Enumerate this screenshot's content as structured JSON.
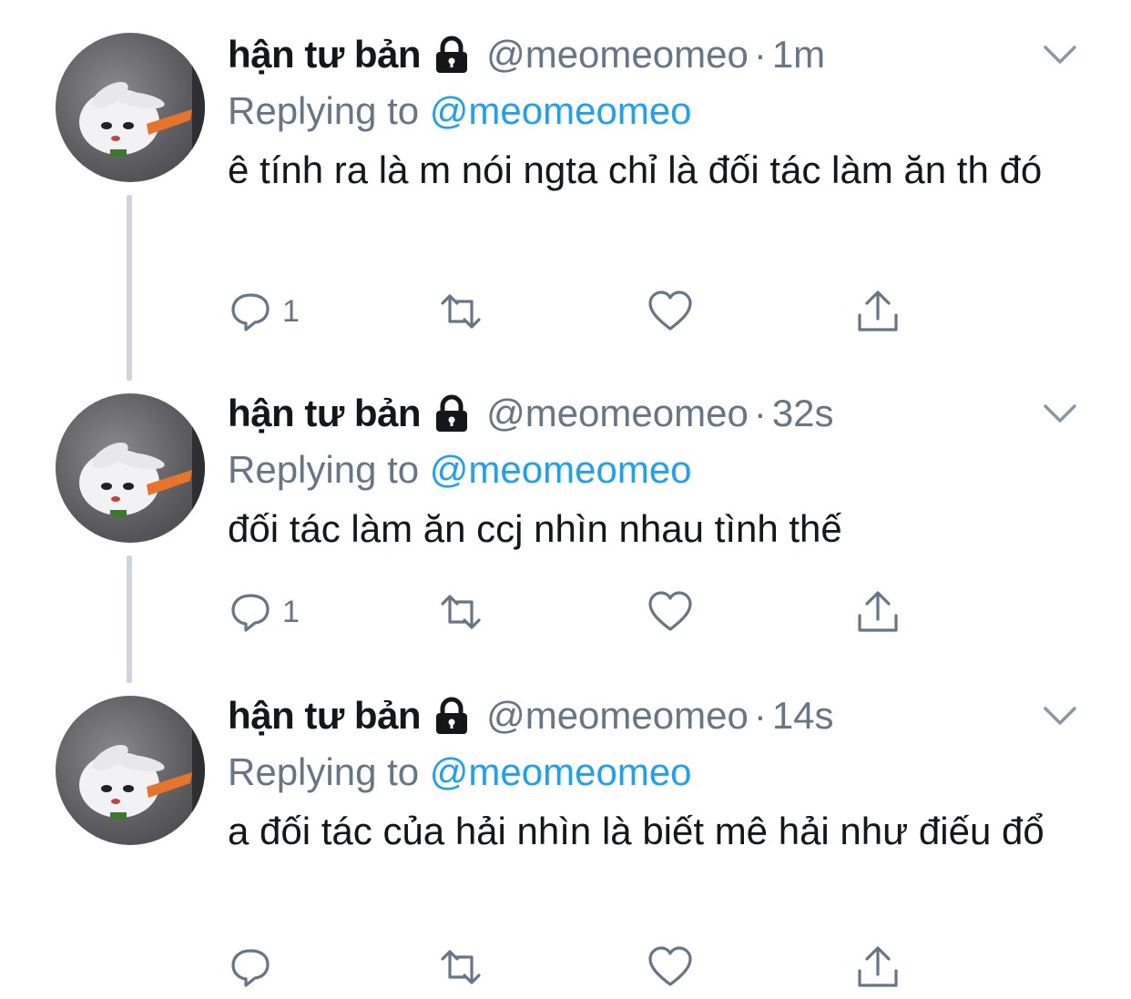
{
  "colors": {
    "text": "#14171a",
    "secondary": "#657786",
    "link": "#1da1f2",
    "thread_line": "#cdd6dd"
  },
  "tweets": [
    {
      "display_name": "hận tư bản",
      "handle": "@meomeomeo",
      "separator": "·",
      "time": "1m",
      "replying_label": "Replying to",
      "replying_to": "@meomeomeo",
      "text": "ê tính ra là m nói ngta chỉ là đối tác làm ăn th đó",
      "reply_count": "1",
      "icons": [
        "lock-icon",
        "chevron-down-icon",
        "reply-icon",
        "retweet-icon",
        "heart-icon",
        "share-icon"
      ]
    },
    {
      "display_name": "hận tư bản",
      "handle": "@meomeomeo",
      "separator": "·",
      "time": "32s",
      "replying_label": "Replying to",
      "replying_to": "@meomeomeo",
      "text": "đối tác làm ăn ccj nhìn nhau tình thế",
      "reply_count": "1",
      "icons": [
        "lock-icon",
        "chevron-down-icon",
        "reply-icon",
        "retweet-icon",
        "heart-icon",
        "share-icon"
      ]
    },
    {
      "display_name": "hận tư bản",
      "handle": "@meomeomeo",
      "separator": "·",
      "time": "14s",
      "replying_label": "Replying to",
      "replying_to": "@meomeomeo",
      "text": "a đối tác của hải nhìn là biết mê hải như điếu đổ",
      "reply_count": "",
      "icons": [
        "lock-icon",
        "chevron-down-icon",
        "reply-icon",
        "retweet-icon",
        "heart-icon",
        "share-icon"
      ]
    }
  ]
}
